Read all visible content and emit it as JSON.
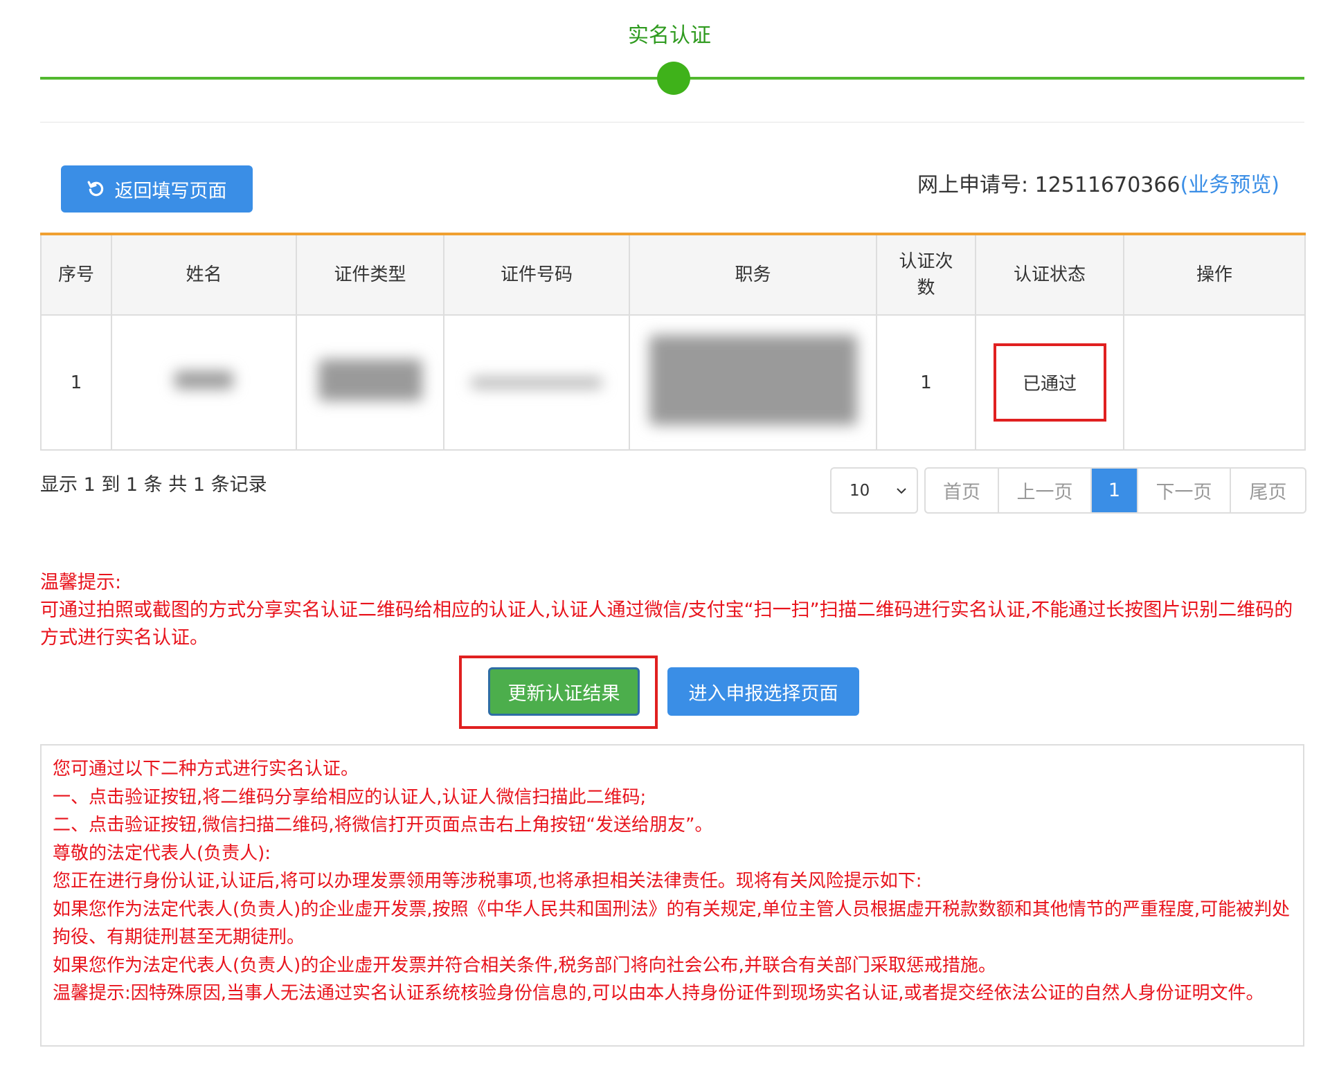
{
  "step": {
    "title": "实名认证"
  },
  "toolbar": {
    "back_label": "返回填写页面",
    "application_label": "网上申请号:",
    "application_no": "12511670366",
    "preview_link": "(业务预览)"
  },
  "table": {
    "headers": [
      "序号",
      "姓名",
      "证件类型",
      "证件号码",
      "职务",
      "认证次数",
      "认证状态",
      "操作"
    ],
    "rows": [
      {
        "index": "1",
        "name": "",
        "id_type": "",
        "id_number": "",
        "position": "",
        "auth_count": "1",
        "status": "已通过",
        "action": ""
      }
    ]
  },
  "summary": "显示 1 到 1 条 共 1 条记录",
  "pagination": {
    "page_size": "10",
    "first": "首页",
    "prev": "上一页",
    "current": "1",
    "next": "下一页",
    "last": "尾页"
  },
  "tips": {
    "title": "温馨提示:",
    "body": "可通过拍照或截图的方式分享实名认证二维码给相应的认证人,认证人通过微信/支付宝“扫一扫”扫描二维码进行实名认证,不能通过长按图片识别二维码的方式进行实名认证。"
  },
  "actions": {
    "update_label": "更新认证结果",
    "enter_label": "进入申报选择页面"
  },
  "notice": {
    "lines": [
      "您可通过以下二种方式进行实名认证。",
      "一、点击验证按钮,将二维码分享给相应的认证人,认证人微信扫描此二维码;",
      "二、点击验证按钮,微信扫描二维码,将微信打开页面点击右上角按钮“发送给朋友”。",
      "尊敬的法定代表人(负责人):",
      "您正在进行身份认证,认证后,将可以办理发票领用等涉税事项,也将承担相关法律责任。现将有关风险提示如下:",
      "如果您作为法定代表人(负责人)的企业虚开发票,按照《中华人民共和国刑法》的有关规定,单位主管人员根据虚开税款数额和其他情节的严重程度,可能被判处拘役、有期徒刑甚至无期徒刑。",
      "如果您作为法定代表人(负责人)的企业虚开发票并符合相关条件,税务部门将向社会公布,并联合有关部门采取惩戒措施。",
      "温馨提示:因特殊原因,当事人无法通过实名认证系统核验身份信息的,可以由本人持身份证件到现场实名认证,或者提交经依法公证的自然人身份证明文件。"
    ]
  },
  "colors": {
    "step_green": "#52b82f",
    "primary_blue": "#3a8ee6",
    "update_green": "#4cae4c",
    "warning_red": "#e8131c",
    "highlight_red": "#e02020",
    "table_top_orange": "#f0a030"
  },
  "icons": {
    "back": "refresh-icon",
    "dropdown": "chevron-down-icon"
  }
}
